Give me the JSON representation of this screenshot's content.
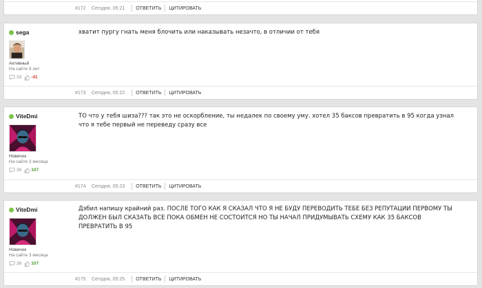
{
  "posts": [
    {
      "number": "#172",
      "time": "Сегодня, 05:21",
      "actions": {
        "reply": "ОТВЕТИТЬ",
        "quote": "ЦИТИРОВАТЬ"
      }
    },
    {
      "author": "sega",
      "rank": "Активный",
      "since": "На сайте 9 лет",
      "messages_count": "33",
      "reputation": "-41",
      "text": "хватит пургу гнать меня блочить или наказывать незачто, в отличии от тебя",
      "number": "#173",
      "time": "Сегодня, 05:22",
      "actions": {
        "reply": "ОТВЕТИТЬ",
        "quote": "ЦИТИРОВАТЬ"
      }
    },
    {
      "author": "ViteDmi",
      "rank": "Новичок",
      "since": "На сайте 3 месяца",
      "messages_count": "26",
      "reputation": "107",
      "text": "ТО что у тебя шиза??? так это не оскорбление, ты недалек по своему уму. хотел 35 баксов превратить в 95 когда узнал что я тебе первый не переведу сразу все",
      "number": "#174",
      "time": "Сегодня, 05:23",
      "actions": {
        "reply": "ОТВЕТИТЬ",
        "quote": "ЦИТИРОВАТЬ"
      }
    },
    {
      "author": "ViteDmi",
      "rank": "Новичок",
      "since": "На сайте 3 месяца",
      "messages_count": "26",
      "reputation": "107",
      "text": "Дэбил напишу крайний раз.   ПОСЛЕ ТОГО КАК Я СКАЗАЛ ЧТО Я НЕ БУДУ ПЕРЕВОДИТЬ ТЕБЕ БЕЗ РЕПУТАЦИИ ПЕРВОМУ ТЫ ДОЛЖЕН БЫЛ СКАЗАТЬ ВСЕ ПОКА ОБМЕН НЕ СОСТОИТСЯ  НО ТЫ НАЧАЛ ПРИДУМЫВАТЬ СХЕМУ КАК 35 БАКСОВ ПРЕВРАТИТЬ В 95",
      "number": "#175",
      "time": "Сегодня, 05:25",
      "actions": {
        "reply": "ОТВЕТИТЬ",
        "quote": "ЦИТИРОВАТЬ"
      }
    }
  ],
  "colors": {
    "online": "#7bc24a",
    "reputation_negative": "#d0392b",
    "reputation_positive": "#4a9a2c"
  },
  "icons": {
    "online": "online-status-icon",
    "messages": "speech-bubble-icon",
    "reputation": "thumbs-up-icon"
  }
}
